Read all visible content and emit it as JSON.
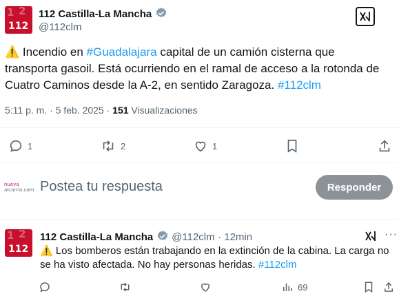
{
  "main_tweet": {
    "author_name": "112 Castilla-La Mancha",
    "handle": "@112clm",
    "avatar_text": "112",
    "text_lines": [
      [
        "⚠️ Incendio en ",
        "#Guadalajara",
        " capital de un camión cisterna que"
      ],
      [
        "transporta gasoil. Está ocurriendo en el ramal de acceso a la rotonda de"
      ],
      [
        "Cuatro Caminos desde la A-2, en sentido Zaragoza. ",
        "#112clm"
      ]
    ],
    "line1_prefix": "⚠️ Incendio en ",
    "line1_hashtag": "#Guadalajara",
    "line1_suffix": " capital de un camión cisterna que",
    "line2": "transporta gasoil. Está ocurriendo en el ramal de acceso a la rotonda de",
    "line3_prefix": "Cuatro Caminos desde la A-2, en sentido Zaragoza. ",
    "line3_hashtag": "#112clm",
    "timestamp": "5:11 p. m. · 5 feb. 2025 · ",
    "views_count": "151",
    "views_label": " Visualizaciones",
    "replies": "1",
    "retweets": "2",
    "likes": "1"
  },
  "composer": {
    "logo_line1": "nueva",
    "logo_line2": "alcarria.com",
    "placeholder": "Postea tu respuesta",
    "button_label": "Responder"
  },
  "reply_tweet": {
    "author_name": "112 Castilla-La Mancha",
    "handle": "@112clm",
    "time": "· 12min",
    "avatar_text": "112",
    "line1": "⚠️ Los bomberos están trabajando en la extinción de la cabina. La carga no",
    "line2_prefix": "se ha visto afectada. No hay personas heridas. ",
    "line2_hashtag": "#112clm",
    "views": "69"
  },
  "colors": {
    "accent": "#1d9bf0",
    "brand_red": "#c8102e",
    "muted": "#536471",
    "button_bg": "#8c9297"
  },
  "icons": [
    "verified-badge-icon",
    "grok-icon",
    "reply-icon",
    "retweet-icon",
    "like-icon",
    "bookmark-icon",
    "share-icon",
    "views-icon"
  ]
}
